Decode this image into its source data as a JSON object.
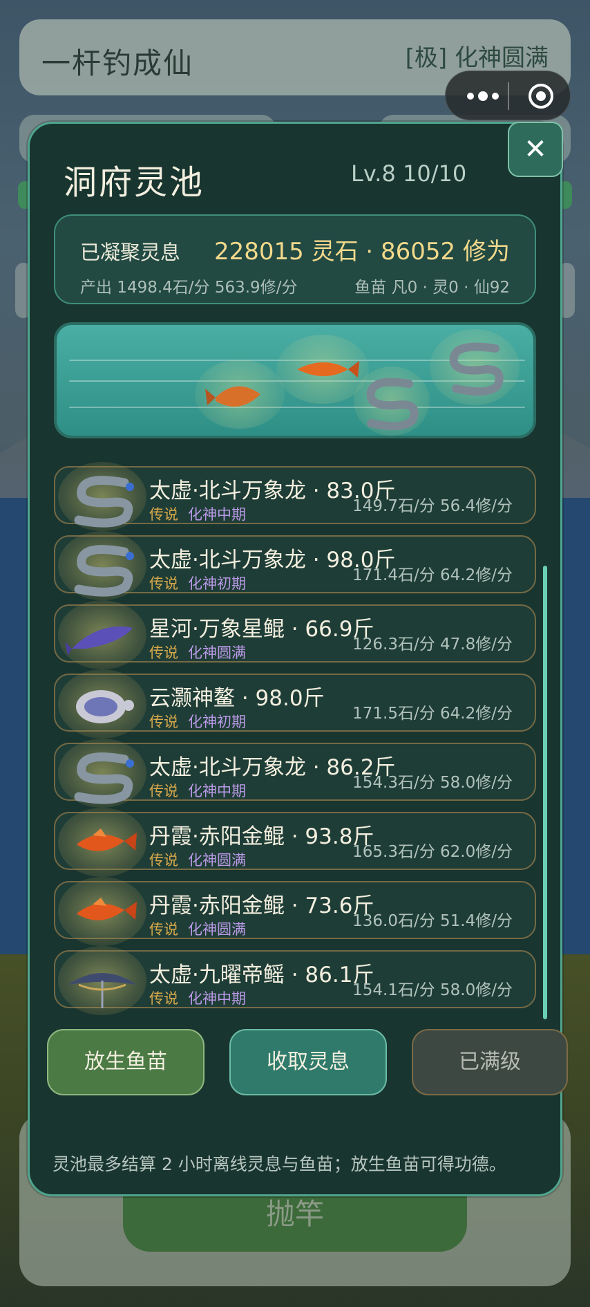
{
  "game": {
    "title": "一杆钓成仙",
    "rank": "[极] 化神圆满",
    "cast_label": "抛竿"
  },
  "modal": {
    "title": "洞府灵池",
    "level": "Lv.8  10/10",
    "close_label": "✕",
    "summary": {
      "label": "已凝聚灵息",
      "total": "228015 灵石  ·  86052 修为",
      "rate": "产出 1498.4石/分  563.9修/分",
      "fry": "鱼苗 凡0 · 灵0 · 仙92"
    },
    "fish": [
      {
        "name": "太虚·北斗万象龙 · 83.0斤",
        "grade": "传说",
        "realm": "化神中期",
        "rate": "149.7石/分 56.4修/分",
        "icon": "dragon-icon"
      },
      {
        "name": "太虚·北斗万象龙 · 98.0斤",
        "grade": "传说",
        "realm": "化神初期",
        "rate": "171.4石/分 64.2修/分",
        "icon": "dragon-icon"
      },
      {
        "name": "星河·万象星鲲 · 66.9斤",
        "grade": "传说",
        "realm": "化神圆满",
        "rate": "126.3石/分 47.8修/分",
        "icon": "whale-icon"
      },
      {
        "name": "云灏神鳌 · 98.0斤",
        "grade": "传说",
        "realm": "化神初期",
        "rate": "171.5石/分 64.2修/分",
        "icon": "turtle-icon"
      },
      {
        "name": "太虚·北斗万象龙 · 86.2斤",
        "grade": "传说",
        "realm": "化神中期",
        "rate": "154.3石/分 58.0修/分",
        "icon": "dragon-icon"
      },
      {
        "name": "丹霞·赤阳金鲲 · 93.8斤",
        "grade": "传说",
        "realm": "化神圆满",
        "rate": "165.3石/分 62.0修/分",
        "icon": "goldfish-icon"
      },
      {
        "name": "丹霞·赤阳金鲲 · 73.6斤",
        "grade": "传说",
        "realm": "化神圆满",
        "rate": "136.0石/分 51.4修/分",
        "icon": "goldfish-icon"
      },
      {
        "name": "太虚·九曜帝鳐 · 86.1斤",
        "grade": "传说",
        "realm": "化神中期",
        "rate": "154.1石/分 58.0修/分",
        "icon": "ray-icon"
      }
    ],
    "buttons": {
      "release": "放生鱼苗",
      "collect": "收取灵息",
      "maxed": "已满级"
    },
    "note": "灵池最多结算 2 小时离线灵息与鱼苗；放生鱼苗可得功德。"
  },
  "colors": {
    "panel": "#193530",
    "accent": "#4fa58e",
    "gold": "#f3d98c",
    "grade": "#d8a94a",
    "realm": "#b99ae6"
  }
}
